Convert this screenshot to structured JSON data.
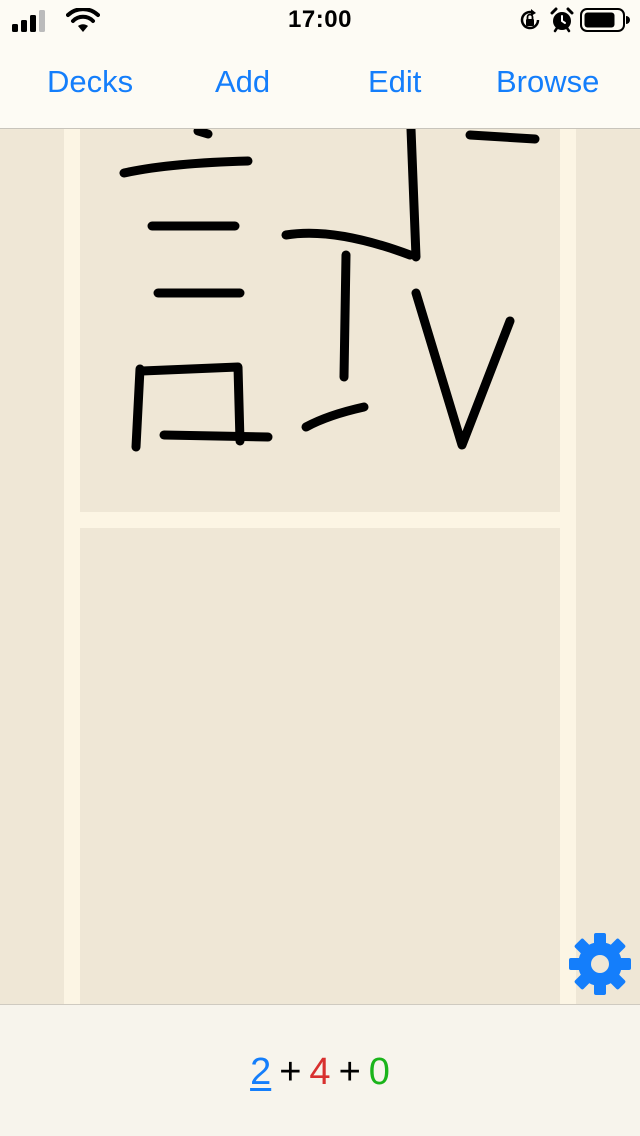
{
  "status_bar": {
    "time": "17:00"
  },
  "nav": {
    "decks_label": "Decks",
    "add_label": "Add",
    "edit_label": "Edit",
    "browse_label": "Browse"
  },
  "counts": {
    "new": "2",
    "separator_1": "+",
    "learning": "4",
    "separator_2": "+",
    "review": "0"
  },
  "icons": {
    "signal": "signal-icon",
    "wifi": "wifi-icon",
    "rotation_lock": "rotation-lock-icon",
    "alarm": "alarm-icon",
    "battery": "battery-icon",
    "settings": "gear-icon"
  },
  "colors": {
    "accent": "#147efb",
    "learning": "#d8302f",
    "review": "#1ab41a",
    "background": "#efe7d6",
    "card_frame": "#fcf5e4"
  }
}
